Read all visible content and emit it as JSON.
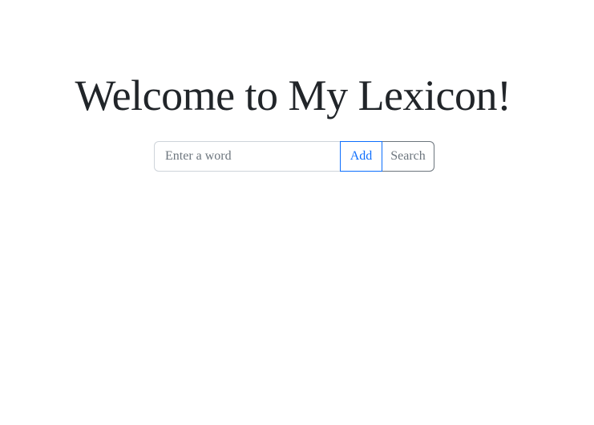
{
  "header": {
    "title": "Welcome to My Lexicon!"
  },
  "form": {
    "word_input": {
      "value": "",
      "placeholder": "Enter a word"
    },
    "add_label": "Add",
    "search_label": "Search"
  },
  "colors": {
    "text": "#212529",
    "primary": "#0d6efd",
    "secondary": "#6c757d",
    "input_border": "#ced4da",
    "background": "#ffffff"
  }
}
